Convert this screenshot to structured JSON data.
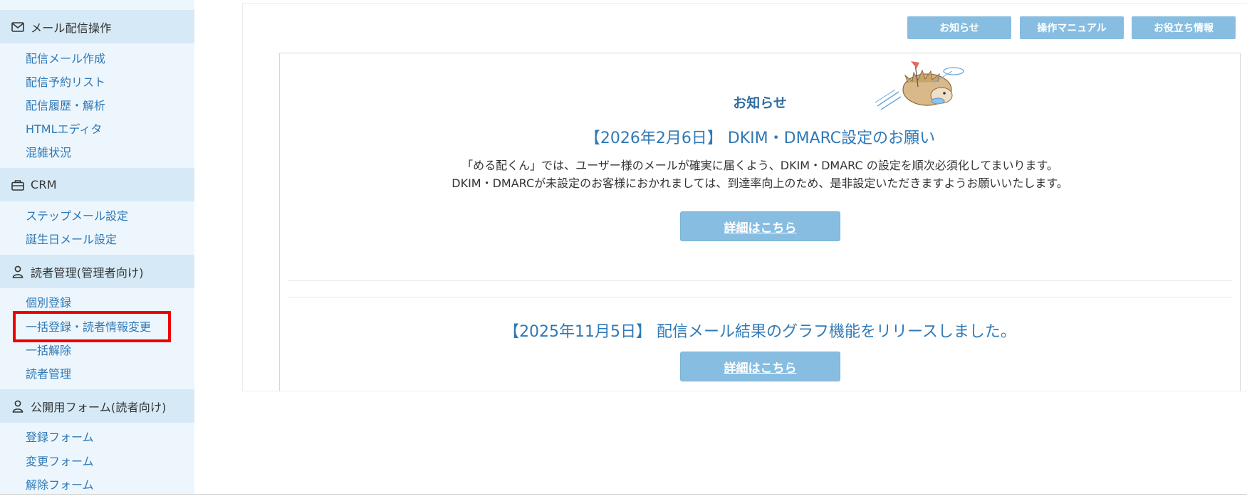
{
  "sidebar": {
    "sections": [
      {
        "title": "メール配信操作",
        "icon": "envelope-icon"
      },
      {
        "title": "CRM",
        "icon": "briefcase-icon"
      },
      {
        "title": "読者管理(管理者向け)",
        "icon": "person-icon"
      },
      {
        "title": "公開用フォーム(読者向け)",
        "icon": "person-icon"
      }
    ],
    "mail_items": [
      "配信メール作成",
      "配信予約リスト",
      "配信履歴・解析",
      "HTMLエディタ",
      "混雑状況"
    ],
    "crm_items": [
      "ステップメール設定",
      "誕生日メール設定"
    ],
    "reader_items": [
      "個別登録",
      "一括登録・読者情報変更",
      "一括解除",
      "読者管理"
    ],
    "form_items": [
      "登録フォーム",
      "変更フォーム",
      "解除フォーム"
    ],
    "highlight_color": "#ee0000"
  },
  "header": {
    "buttons": [
      "お知らせ",
      "操作マニュアル",
      "お役立ち情報"
    ]
  },
  "notices": {
    "title": "お知らせ",
    "items": [
      {
        "heading": "【2026年2月6日】 DKIM・DMARC設定のお願い",
        "body_line1": "「める配くん」では、ユーザー様のメールが確実に届くよう、DKIM・DMARC の設定を順次必須化してまいります。",
        "body_line2": "DKIM・DMARCが未設定のお客様におかれましては、到達率向上のため、是非設定いただきますようお願いいたします。",
        "button": "詳細はこちら"
      },
      {
        "heading": "【2025年11月5日】 配信メール結果のグラフ機能をリリースしました。",
        "button": "詳細はこちら"
      }
    ]
  },
  "colors": {
    "sidebar_bg": "#edf6fc",
    "section_bg": "#d5eaf6",
    "link": "#2f79b7",
    "button_bg": "#87bde0"
  }
}
